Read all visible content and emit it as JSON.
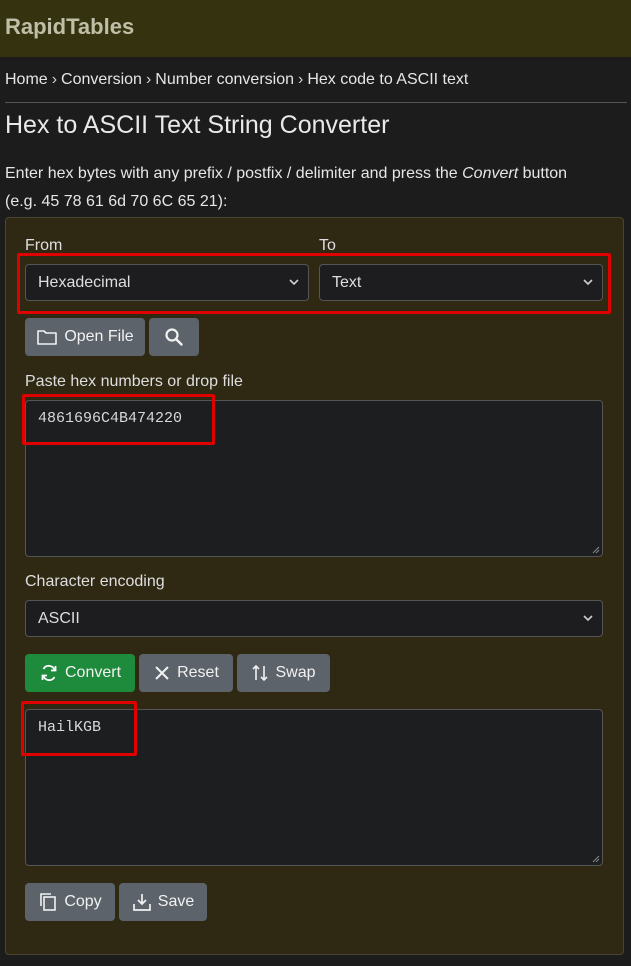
{
  "header": {
    "brand": "RapidTables"
  },
  "breadcrumb": {
    "items": [
      "Home",
      "Conversion",
      "Number conversion",
      "Hex code to ASCII text"
    ],
    "separator": "›"
  },
  "page": {
    "title": "Hex to ASCII Text String Converter",
    "intro_before": "Enter hex bytes with any prefix / postfix / delimiter and press the ",
    "intro_em": "Convert",
    "intro_after": " button",
    "intro_line2": "(e.g. 45 78 61 6d 70 6C 65 21):"
  },
  "form": {
    "from_label": "From",
    "to_label": "To",
    "from_value": "Hexadecimal",
    "to_value": "Text",
    "open_file_label": "Open File",
    "input_label": "Paste hex numbers or drop file",
    "input_value": "4861696C4B474220",
    "encoding_label": "Character encoding",
    "encoding_value": "ASCII",
    "convert_label": "Convert",
    "reset_label": "Reset",
    "swap_label": "Swap",
    "output_value": "HailKGB",
    "copy_label": "Copy",
    "save_label": "Save"
  },
  "colors": {
    "header_bg": "#34320f",
    "panel_bg": "#2f2914",
    "convert_green": "#1e8a3c",
    "button_gray": "#5c636a",
    "highlight_red": "#e00000"
  },
  "icons": [
    "folder-icon",
    "search-icon",
    "refresh-icon",
    "close-icon",
    "swap-icon",
    "copy-icon",
    "download-icon",
    "chevron-down-icon"
  ]
}
